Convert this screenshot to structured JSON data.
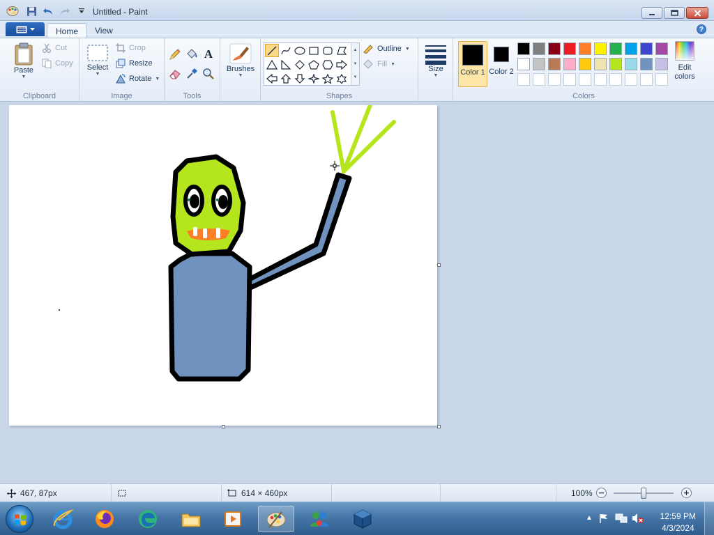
{
  "window": {
    "title": "Untitled - Paint"
  },
  "tabs": [
    {
      "label": "Home",
      "active": true
    },
    {
      "label": "View",
      "active": false
    }
  ],
  "help": "?",
  "clipboard": {
    "paste": "Paste",
    "cut": "Cut",
    "copy": "Copy",
    "label": "Clipboard"
  },
  "image": {
    "select": "Select",
    "crop": "Crop",
    "resize": "Resize",
    "rotate": "Rotate",
    "label": "Image"
  },
  "tools": {
    "label": "Tools",
    "text_glyph": "A"
  },
  "brushes": {
    "label": "Brushes"
  },
  "shapes": {
    "outline": "Outline",
    "fill": "Fill",
    "label": "Shapes"
  },
  "size": {
    "label": "Size"
  },
  "colors": {
    "color1": "Color 1",
    "color1_value": "#000000",
    "color2": "Color 2",
    "color2_value": "#000000",
    "edit": "Edit colors",
    "label": "Colors",
    "palette_row1": [
      "#000000",
      "#7f7f7f",
      "#880015",
      "#ed1c24",
      "#ff7f27",
      "#fff200",
      "#22b14c",
      "#00a2e8",
      "#3f48cc",
      "#a349a4"
    ],
    "palette_row2": [
      "#ffffff",
      "#c3c3c3",
      "#b97a57",
      "#ffaec9",
      "#ffc90e",
      "#efe4b0",
      "#b5e61d",
      "#99d9ea",
      "#7092be",
      "#c8bfe7"
    ]
  },
  "status": {
    "cursor_pos": "467, 87px",
    "canvas_size": "614 × 460px",
    "zoom": "100%",
    "zoom_fraction": 0.5
  },
  "taskbar": {
    "time": "12:59 PM",
    "date": "4/3/2024"
  }
}
